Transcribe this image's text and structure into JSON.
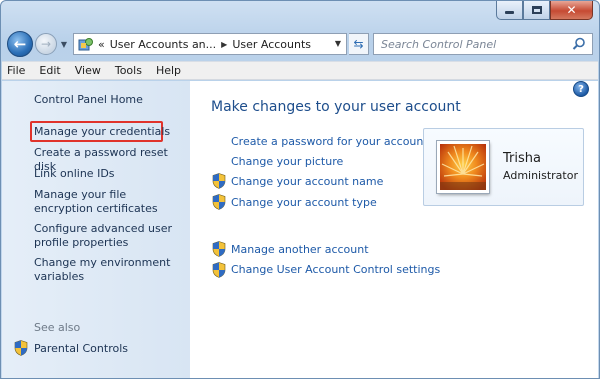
{
  "window": {
    "caption_buttons": {
      "minimize": "minimize-icon",
      "maximize": "maximize-icon",
      "close": "close-icon"
    }
  },
  "navigation": {
    "address_overflow": "«",
    "breadcrumbs": [
      "User Accounts an...",
      "User Accounts"
    ],
    "search_placeholder": "Search Control Panel"
  },
  "menu": [
    "File",
    "Edit",
    "View",
    "Tools",
    "Help"
  ],
  "left_pane": {
    "home": "Control Panel Home",
    "tasks": [
      "Manage your credentials",
      "Create a password reset disk",
      "Link online IDs",
      "Manage your file encryption certificates",
      "Configure advanced user profile properties",
      "Change my environment variables"
    ],
    "see_also_label": "See also",
    "see_also_items": [
      "Parental Controls"
    ]
  },
  "main": {
    "heading": "Make changes to your user account",
    "tasks": [
      {
        "label": "Create a password for your account",
        "icon": "none"
      },
      {
        "label": "Change your picture",
        "icon": "none"
      },
      {
        "label": "Change your account name",
        "icon": "uac-shield-icon"
      },
      {
        "label": "Change your account type",
        "icon": "uac-shield-icon"
      },
      {
        "label": "Manage another account",
        "icon": "uac-shield-icon"
      },
      {
        "label": "Change User Account Control settings",
        "icon": "uac-shield-icon"
      }
    ]
  },
  "user": {
    "name": "Trisha",
    "role": "Administrator"
  },
  "colors": {
    "link": "#1e5aa8",
    "heading": "#1e4e8c",
    "highlight_box": "#e0332b",
    "left_pane": "#dde8f5"
  }
}
